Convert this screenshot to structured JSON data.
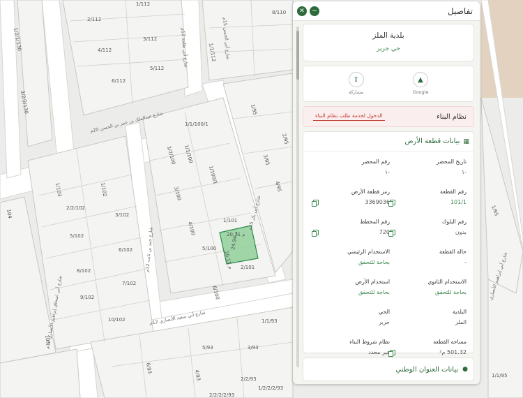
{
  "panel": {
    "title": "تفاصيل",
    "close_symbol": "✕",
    "minimize_symbol": "−",
    "municipality": "بلدية الملز",
    "district": "حي جرير",
    "share_label": "مشاركة",
    "google_label": "Google",
    "building_system_label": "نظام البناء",
    "building_system_link": "الدخول لخدمة طلب نظام البناء",
    "land_section_title": "بيانات قطعة الأرض",
    "fields": {
      "report_date_label": "تاريخ المحضر",
      "report_date_value": "-١",
      "report_no_label": "رقم المحضر",
      "report_no_value": "-١",
      "parcel_no_label": "رقم القطعة",
      "parcel_no_value": "101/1",
      "land_code_label": "رمز قطعة الأرض",
      "land_code_value": "3369036",
      "block_no_label": "رقم البلوك",
      "block_no_value": "بدون",
      "plan_no_label": "رقم المخطط",
      "plan_no_value": "720",
      "parcel_status_label": "حالة القطعة",
      "parcel_status_value": "-",
      "main_use_label": "الاستخدام الرئيسي",
      "main_use_value": "بحاجة للتحقق",
      "secondary_use_label": "الاستخدام الثانوي",
      "secondary_use_value": "بحاجة للتحقق",
      "land_use_label": "استخدام الأرض",
      "land_use_value": "بحاجة للتحقق",
      "municipality_label": "البلدية",
      "municipality_value": "الملز",
      "district_label": "الحي",
      "district_value": "جرير",
      "area_label": "مساحة القطعة",
      "area_value": "501.32 م²",
      "building_cond_label": "نظام شروط البناء",
      "building_cond_value": "غير محدد"
    },
    "address_section_title": "بيانات العنوان الوطني"
  },
  "map": {
    "parcels": [
      "1/112",
      "2/112",
      "3/112",
      "4/112",
      "5/112",
      "6/112",
      "1/1/130",
      "1/2/2/130",
      "3/2/2/130",
      "1/1/100",
      "1/2/100",
      "1/1/95",
      "2/95",
      "3/95",
      "4/95",
      "5/95",
      "1/95",
      "1/103",
      "2/102",
      "3/102",
      "4/102",
      "5/102",
      "6/102",
      "7/102",
      "8/102",
      "9/102",
      "10/102",
      "1/100",
      "2/100",
      "3/100",
      "4/100",
      "5/100",
      "6/100",
      "1/101",
      "2/101",
      "1/1/93",
      "2/93",
      "3/93",
      "4/93",
      "5/93",
      "6/93",
      "1/93",
      "104",
      "103",
      "1/2/2/2/93",
      "2/2/2/2/93",
      "1/1/95"
    ],
    "selected_parcel": "101/1",
    "selected_dims": [
      "20.11 م",
      "24.94 م",
      "20.11 م"
    ],
    "streets": [
      "شارع عبدالملك بن عمر بن الحسن 20م",
      "شارع حمد بن ثابت 12م",
      "شارع أبي الحسن بن عبدالملك 15م",
      "شارع أبي طلحة الأنصاري 12م",
      "شارع أبي سعيد الأنصاري 12م",
      "شارع أبي بكر الصديق 15م",
      "شارع أبي اسحاق إبراهيم الأنصاري 12م"
    ],
    "colors": {
      "road": "#ffffff",
      "block": "#ececea",
      "line": "#c8c8c4",
      "selected": "#8fcf9a"
    }
  }
}
